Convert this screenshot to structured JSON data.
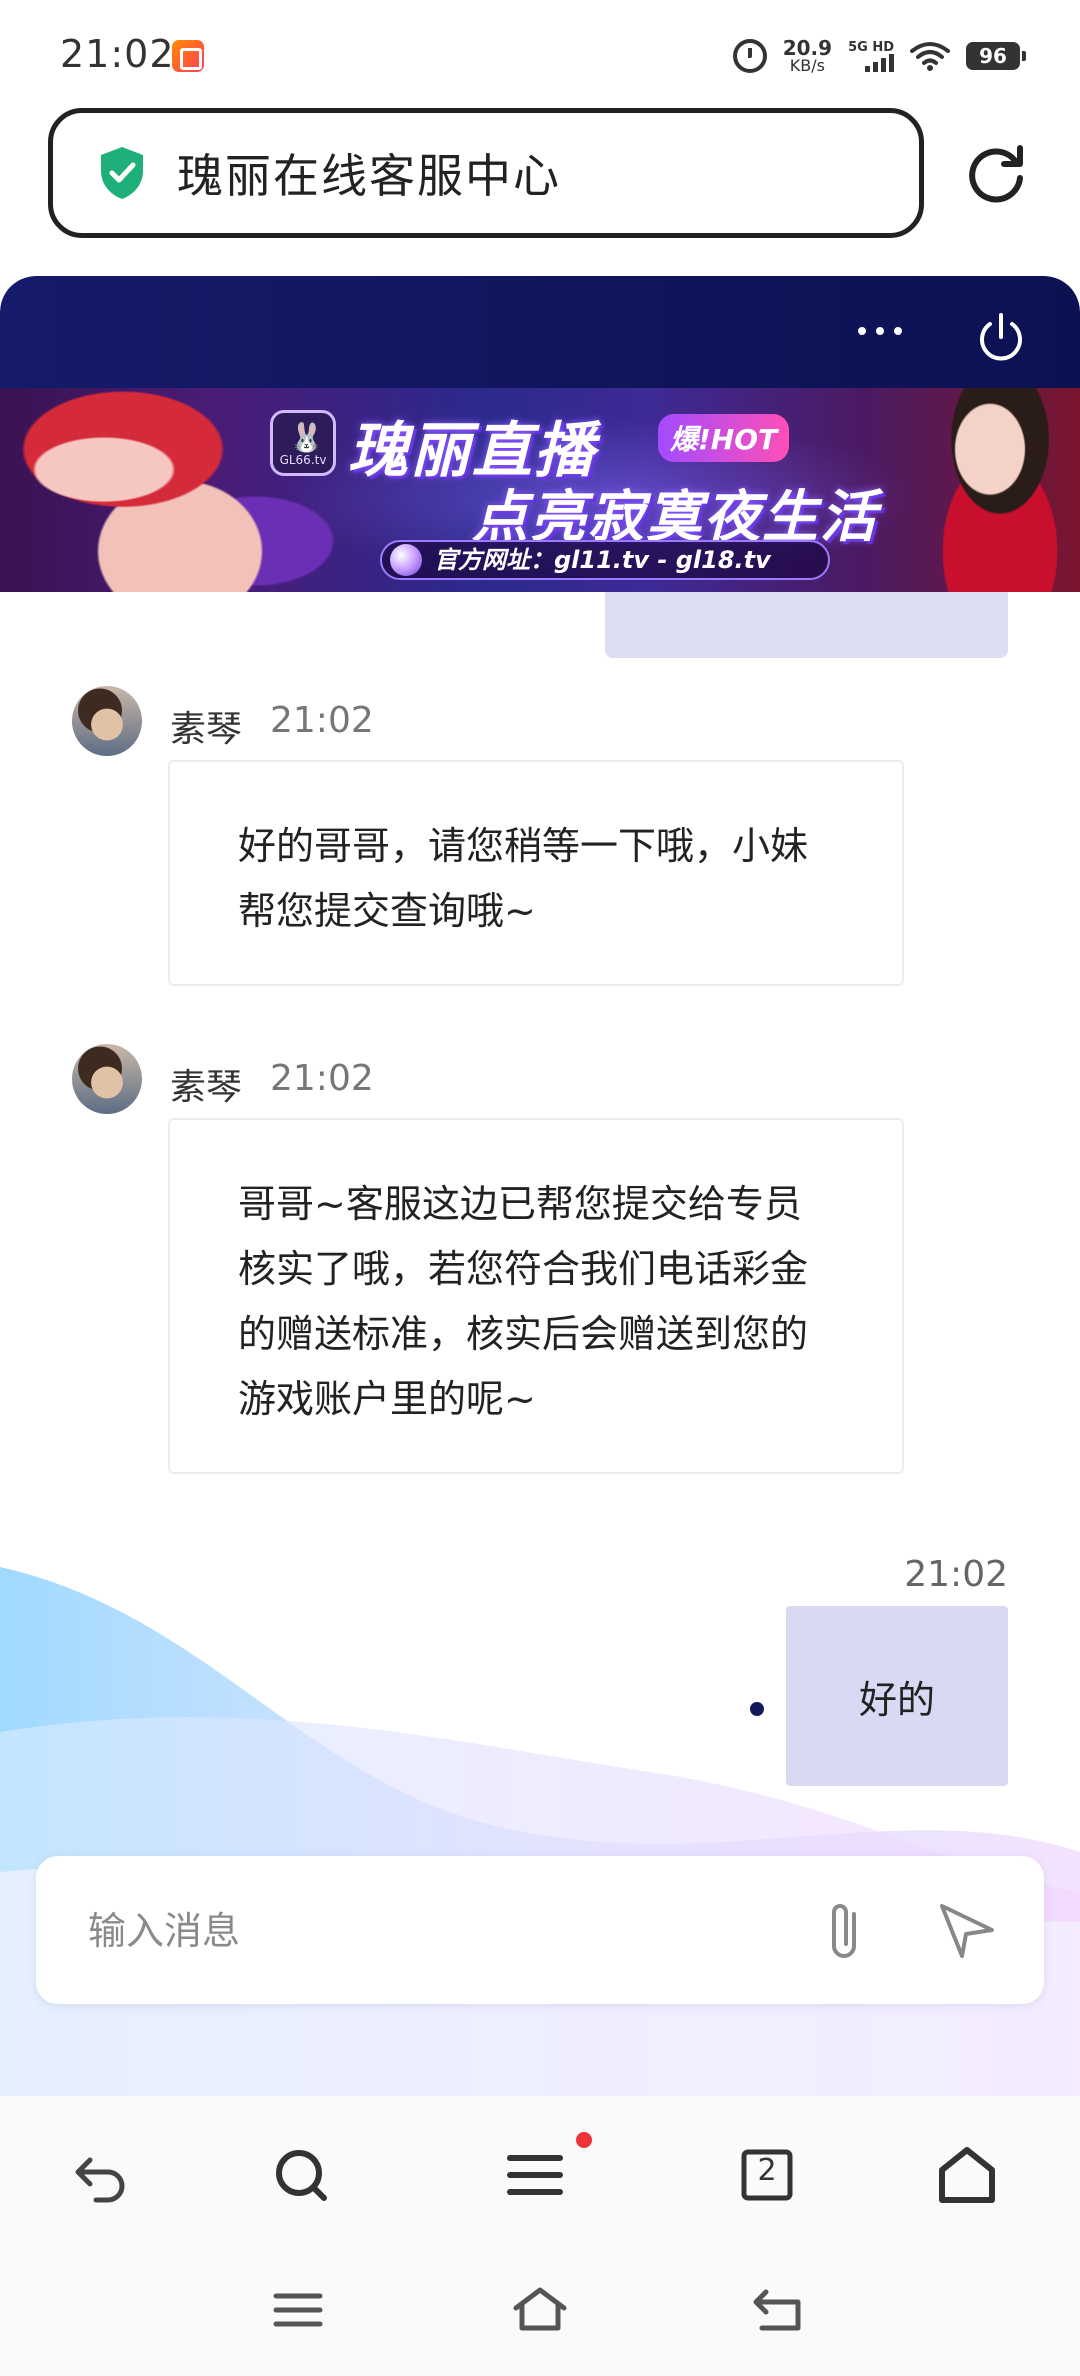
{
  "status_bar": {
    "time": "21:02",
    "net_speed_value": "20.9",
    "net_speed_unit": "KB/s",
    "network_type": "5G HD",
    "battery": "96",
    "icons": [
      "app-notification-icon",
      "alarm-icon",
      "signal-icon",
      "wifi-icon",
      "battery-icon"
    ]
  },
  "url_bar": {
    "title": "瑰丽在线客服中心",
    "security_icon": "shield-check-icon",
    "refresh_icon": "refresh-icon"
  },
  "chat_header": {
    "more_icon": "more-icon",
    "power_icon": "power-icon"
  },
  "banner": {
    "title": "瑰丽直播",
    "badge": "爆!HOT",
    "subtitle": "点亮寂寞夜生活",
    "website": "官方网址：gl11.tv - gl18.tv",
    "logo_text": "GL66.tv"
  },
  "messages": [
    {
      "sender": "素琴",
      "time": "21:02",
      "text": "好的哥哥，请您稍等一下哦，小妹帮您提交查询哦~"
    },
    {
      "sender": "素琴",
      "time": "21:02",
      "text": "哥哥~客服这边已帮您提交给专员核实了哦，若您符合我们电话彩金的赠送标准，核实后会赠送到您的游戏账户里的呢~"
    }
  ],
  "sent_message": {
    "time": "21:02",
    "text": "好的"
  },
  "composer": {
    "placeholder": "输入消息",
    "attach_icon": "paperclip-icon",
    "send_icon": "send-icon"
  },
  "browser_toolbar": {
    "tab_count": "2",
    "icons": [
      "back-icon",
      "search-icon",
      "menu-icon",
      "tabs-icon",
      "home-icon"
    ],
    "menu_has_notification": true
  },
  "system_nav": {
    "icons": [
      "recent-apps-icon",
      "home-nav-icon",
      "back-nav-icon"
    ]
  },
  "colors": {
    "header_bg": "#0c1152",
    "sent_bubble": "#d9d9f3",
    "notification_dot": "#f0323a",
    "shield": "#1fb07a"
  }
}
